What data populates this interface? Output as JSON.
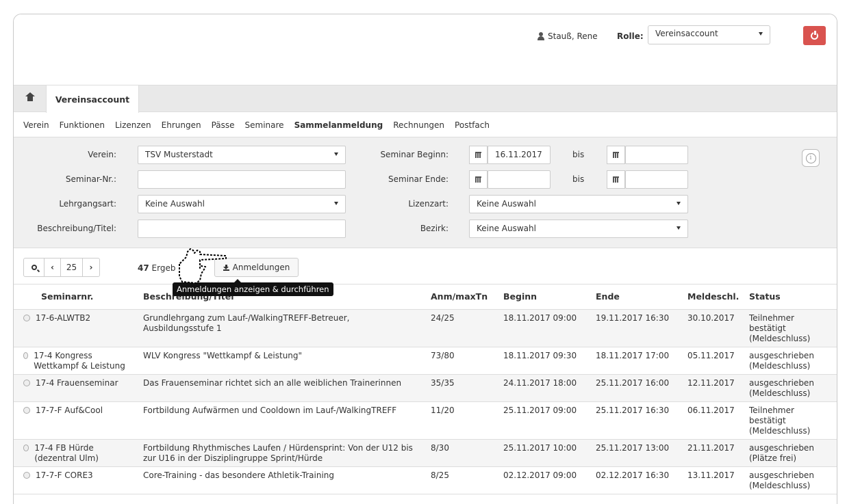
{
  "header": {
    "user_name": "Stauß, Rene",
    "role_label": "Rolle:",
    "role_value": "Vereinsaccount"
  },
  "tabs": {
    "active_tab": "Vereinsaccount"
  },
  "subnav": [
    "Verein",
    "Funktionen",
    "Lizenzen",
    "Ehrungen",
    "Pässe",
    "Seminare",
    "Sammelanmeldung",
    "Rechnungen",
    "Postfach"
  ],
  "subnav_active": "Sammelanmeldung",
  "filter": {
    "verein_label": "Verein:",
    "verein_value": "TSV Musterstadt",
    "seminar_nr_label": "Seminar-Nr.:",
    "seminar_nr_value": "",
    "lehrgangsart_label": "Lehrgangsart:",
    "lehrgangsart_value": "Keine Auswahl",
    "beschreibung_label": "Beschreibung/Titel:",
    "beschreibung_value": "",
    "beginn_label": "Seminar Beginn:",
    "beginn_from": "16.11.2017",
    "beginn_to": "",
    "ende_label": "Seminar Ende:",
    "ende_from": "",
    "ende_to": "",
    "bis_label": "bis",
    "lizenzart_label": "Lizenzart:",
    "lizenzart_value": "Keine Auswahl",
    "bezirk_label": "Bezirk:",
    "bezirk_value": "Keine Auswahl"
  },
  "toolbar": {
    "page_size": "25",
    "results_count": "47",
    "results_text": "Ergeb",
    "anmeldungen_label": "Anmeldungen",
    "tooltip": "Anmeldungen anzeigen & durchführen"
  },
  "table": {
    "headers": [
      "Seminarnr.",
      "Beschreibung/Titel",
      "Anm/maxTn",
      "Beginn",
      "Ende",
      "Meldeschl.",
      "Status"
    ],
    "rows": [
      {
        "nr": "17-6-ALWTB2",
        "title": "Grundlehrgang zum Lauf-/WalkingTREFF-Betreuer, Ausbildungsstufe 1",
        "anm": "24/25",
        "beginn": "18.11.2017 09:00",
        "ende": "19.11.2017 16:30",
        "meldeschl": "30.10.2017",
        "status": "Teilnehmer bestätigt (Meldeschluss)"
      },
      {
        "nr": "17-4 Kongress Wettkampf & Leistung",
        "title": "WLV Kongress \"Wettkampf & Leistung\"",
        "anm": "73/80",
        "beginn": "18.11.2017 09:30",
        "ende": "18.11.2017 17:00",
        "meldeschl": "05.11.2017",
        "status": "ausgeschrieben (Meldeschluss)"
      },
      {
        "nr": "17-4 Frauenseminar",
        "title": "Das Frauenseminar richtet sich an alle weiblichen Trainerinnen",
        "anm": "35/35",
        "beginn": "24.11.2017 18:00",
        "ende": "25.11.2017 16:00",
        "meldeschl": "12.11.2017",
        "status": "ausgeschrieben (Meldeschluss)"
      },
      {
        "nr": "17-7-F Auf&Cool",
        "title": "Fortbildung Aufwärmen und Cooldown im Lauf-/WalkingTREFF",
        "anm": "11/20",
        "beginn": "25.11.2017 09:00",
        "ende": "25.11.2017 16:30",
        "meldeschl": "06.11.2017",
        "status": "Teilnehmer bestätigt (Meldeschluss)"
      },
      {
        "nr": "17-4 FB Hürde (dezentral Ulm)",
        "title": "Fortbildung Rhythmisches Laufen / Hürdensprint: Von der U12 bis zur U16 in der Disziplingruppe Sprint/Hürde",
        "anm": "8/30",
        "beginn": "25.11.2017 10:00",
        "ende": "25.11.2017 13:00",
        "meldeschl": "21.11.2017",
        "status": "ausgeschrieben (Plätze frei)"
      },
      {
        "nr": "17-7-F CORE3",
        "title": "Core-Training - das besondere Athletik-Training",
        "anm": "8/25",
        "beginn": "02.12.2017 09:00",
        "ende": "02.12.2017 16:30",
        "meldeschl": "13.11.2017",
        "status": "ausgeschrieben (Meldeschluss)"
      }
    ]
  },
  "icons": [
    "user-icon",
    "power-icon",
    "home-icon",
    "calendar-icon",
    "info-icon",
    "search-icon",
    "chevron-left-icon",
    "chevron-right-icon",
    "download-icon",
    "hand-cursor-icon"
  ],
  "colors": {
    "power_button": "#d9534f",
    "tabbar": "#e9e9e9",
    "filter_bg": "#f0f0f0",
    "tooltip_bg": "#111111"
  }
}
